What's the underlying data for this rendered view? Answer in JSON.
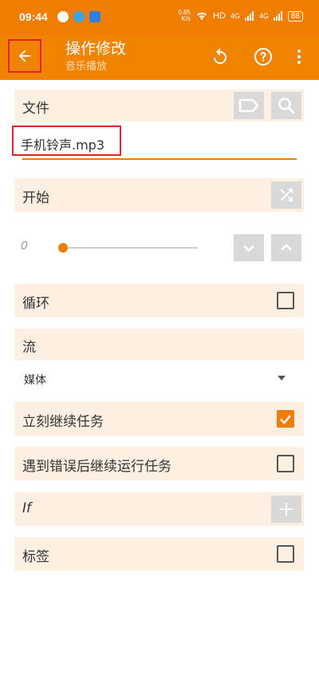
{
  "status": {
    "time": "09:44",
    "net_up": "0.85",
    "net_unit": "K/s",
    "hd_label": "HD",
    "signal1": "4G",
    "signal2": "4G",
    "battery": "88"
  },
  "toolbar": {
    "title": "操作修改",
    "subtitle": "音乐播放"
  },
  "colors": {
    "accent": "#ef7d00",
    "toolbar": "#f08300",
    "row_bg": "#fdf0e2",
    "highlight_box": "#e2232a"
  },
  "form": {
    "file_label": "文件",
    "file_value": "手机铃声.mp3",
    "start_label": "开始",
    "slider_value": "0",
    "slider_fraction": 0,
    "loop_label": "循环",
    "loop_checked": false,
    "stream_label": "流",
    "stream_value": "媒体",
    "continue_now_label": "立刻继续任务",
    "continue_now_checked": true,
    "continue_on_error_label": "遇到错误后继续运行任务",
    "continue_on_error_checked": false,
    "if_label": "If",
    "tag_label": "标签",
    "tag_checked": false
  },
  "icons": [
    "back-arrow-icon",
    "undo-icon",
    "help-icon",
    "more-vert-icon",
    "tag-icon",
    "search-icon",
    "shuffle-icon",
    "chevron-down-icon",
    "chevron-up-icon",
    "dropdown-arrow-icon",
    "plus-icon",
    "checkmark-icon"
  ]
}
